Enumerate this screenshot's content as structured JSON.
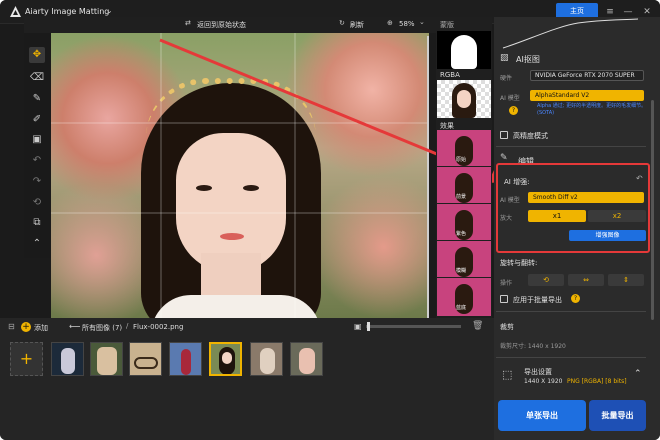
{
  "app": {
    "title": "Aiarty Image Matting",
    "home_label": "主页"
  },
  "toolbar": {
    "reset_label": "返回到原始状态",
    "refresh_label": "刷新",
    "zoom": "58%"
  },
  "preview": {
    "mask_label": "蒙版",
    "rgba_label": "RGBA",
    "effect_label": "效果",
    "effect_captions": [
      "原始",
      "前景",
      "紫色",
      "模糊",
      "蓝底"
    ]
  },
  "right": {
    "ai_matting_title": "AI抠图",
    "hardware_label": "硬件",
    "hardware_value": "NVIDIA GeForce RTX 2070 SUPER",
    "ai_model_label": "AI 模型",
    "ai_model_value": "AlphaStandard  V2",
    "model_hint": "Alpha 通过; 更好的半透明度。更好的毛发细节。(SOTA)",
    "hq_label": "高精度模式",
    "edit_label": "编辑",
    "enhance_title": "AI 增强:",
    "enhance_model_label": "AI 模型",
    "enhance_model_value": "Smooth Diff v2",
    "zoom_label": "放大",
    "x1": "x1",
    "x2": "x2",
    "enhance_button": "增强图像",
    "rotate_title": "旋转与翻转:",
    "rotate_op_label": "操作",
    "apply_batch_label": "应用于批量导出",
    "crop_title": "裁剪",
    "crop_size": "裁剪尺寸: 1440 x 1920",
    "export_settings_title": "导出设置",
    "export_dim": "1440 X 1920",
    "export_fmt": "PNG [RGBA] [8 bits]",
    "export_single": "单张导出",
    "export_batch": "批量导出"
  },
  "bottom": {
    "add_label": "添加",
    "all_images": "所有图像 (7)",
    "filename": "Flux-0002.png"
  },
  "colors": {
    "accent": "#1e6fe0",
    "yellow": "#f0b400",
    "highlight": "#e53939",
    "pink": "#c8437e"
  }
}
